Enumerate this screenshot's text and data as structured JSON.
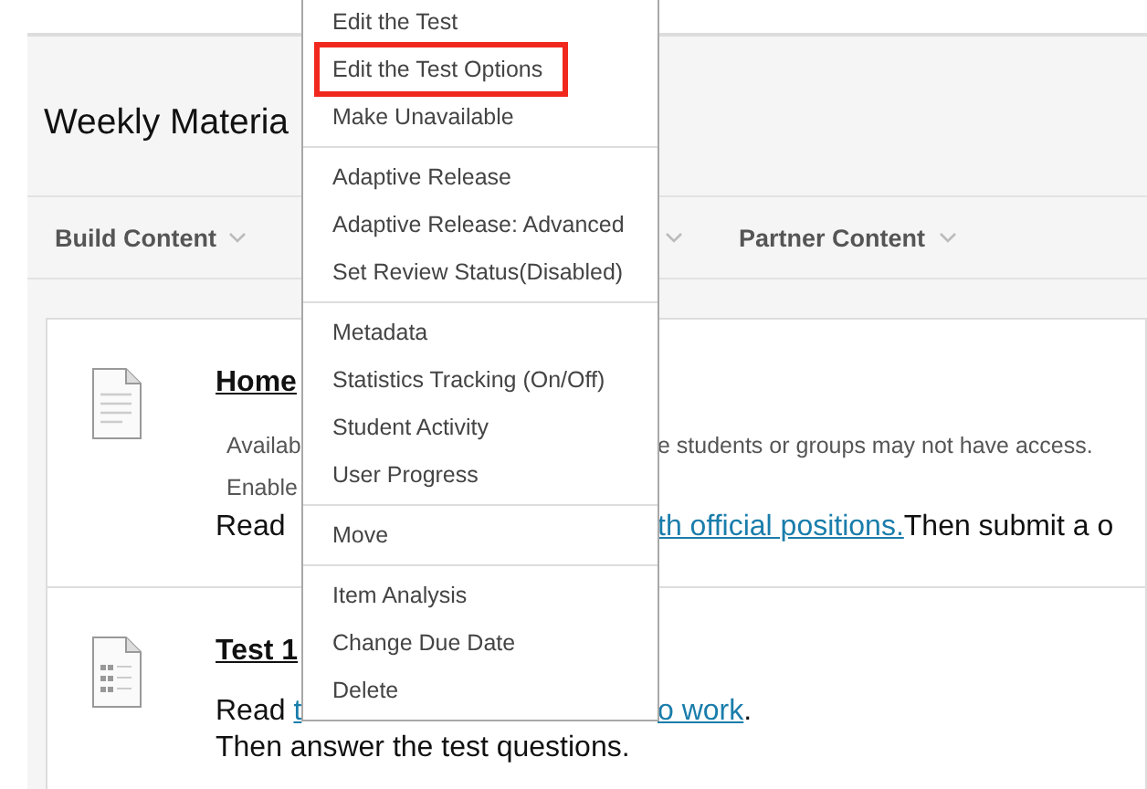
{
  "page_title": "Weekly Materia",
  "toolbar": {
    "left": "Build Content",
    "right": "Partner Content"
  },
  "cards": [
    {
      "kind": "document",
      "title": "Home",
      "lines": [
        {
          "kind": "meta",
          "left": "Availab",
          "right": "e students or groups may not have access."
        },
        {
          "kind": "meta",
          "left": "Enable"
        },
        {
          "kind": "body",
          "left": "Read ",
          "right_link": "th official positions.",
          "right": "Then submit a o"
        }
      ]
    },
    {
      "kind": "test",
      "title": "Test 1",
      "lines": [
        {
          "kind": "body",
          "left": "Read ",
          "left_link": "t",
          "right_link": "o work",
          "right": "."
        },
        {
          "kind": "body",
          "left": "Then answer the test questions."
        }
      ]
    }
  ],
  "menu": [
    [
      {
        "label": "Edit the Test",
        "highlighted": false
      },
      {
        "label": "Edit the Test Options",
        "highlighted": true
      },
      {
        "label": "Make Unavailable",
        "highlighted": false
      }
    ],
    [
      {
        "label": "Adaptive Release",
        "highlighted": false
      },
      {
        "label": "Adaptive Release: Advanced",
        "highlighted": false
      },
      {
        "label": "Set Review Status(Disabled)",
        "highlighted": false
      }
    ],
    [
      {
        "label": "Metadata",
        "highlighted": false
      },
      {
        "label": "Statistics Tracking (On/Off)",
        "highlighted": false
      },
      {
        "label": "Student Activity",
        "highlighted": false
      },
      {
        "label": "User Progress",
        "highlighted": false
      }
    ],
    [
      {
        "label": "Move",
        "highlighted": false
      }
    ],
    [
      {
        "label": "Item Analysis",
        "highlighted": false
      },
      {
        "label": "Change Due Date",
        "highlighted": false
      },
      {
        "label": "Delete",
        "highlighted": false
      }
    ]
  ]
}
